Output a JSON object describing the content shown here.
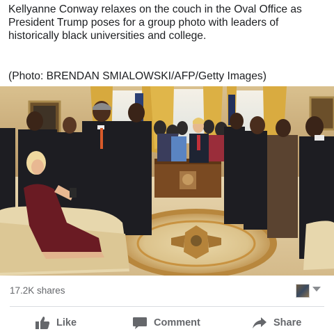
{
  "post": {
    "caption": "Kellyanne Conway relaxes on the couch in the Oval Office as President Trump poses for a group photo with leaders of historically black universities and college.",
    "credit": "(Photo: BRENDAN SMIALOWSKI/AFP/Getty Images)"
  },
  "stats": {
    "shares": "17.2K shares"
  },
  "actions": {
    "like": "Like",
    "comment": "Comment",
    "share": "Share"
  },
  "icons": {
    "like": "thumbs-up-icon",
    "comment": "speech-bubble-icon",
    "share": "share-arrow-icon",
    "menu": "chevron-down-icon"
  },
  "colors": {
    "text": "#1c1e21",
    "muted": "#65676b",
    "divider": "#dadde1"
  }
}
